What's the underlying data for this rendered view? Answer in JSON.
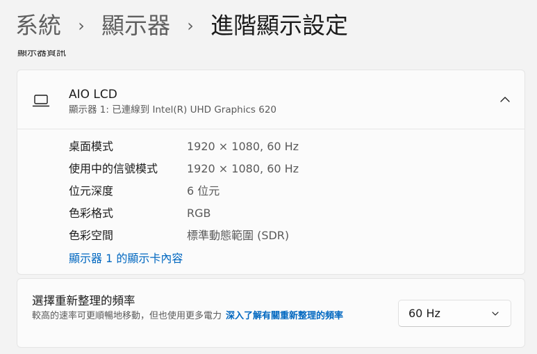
{
  "breadcrumb": {
    "items": [
      "系統",
      "顯示器"
    ],
    "current": "進階顯示設定",
    "separator": "›"
  },
  "section": {
    "title": "顯示器資訊"
  },
  "display": {
    "name": "AIO LCD",
    "connection": "顯示器 1: 已連線到 Intel(R) UHD Graphics 620",
    "expanded": true,
    "icon": "laptop-icon",
    "properties": [
      {
        "label": "桌面模式",
        "value": "1920 × 1080, 60 Hz"
      },
      {
        "label": "使用中的信號模式",
        "value": "1920 × 1080, 60 Hz"
      },
      {
        "label": "位元深度",
        "value": "6 位元"
      },
      {
        "label": "色彩格式",
        "value": "RGB"
      },
      {
        "label": "色彩空間",
        "value": "標準動態範圍 (SDR)"
      }
    ],
    "adapter_link": "顯示器 1 的顯示卡內容"
  },
  "refresh": {
    "title": "選擇重新整理的頻率",
    "description": "較高的速率可更順暢地移動，但也使用更多電力",
    "link": "深入了解有關重新整理的頻率",
    "selected_rate": "60 Hz"
  },
  "colors": {
    "accent": "#0067c0",
    "background": "#f3f3f3",
    "card": "#fbfbfb"
  }
}
